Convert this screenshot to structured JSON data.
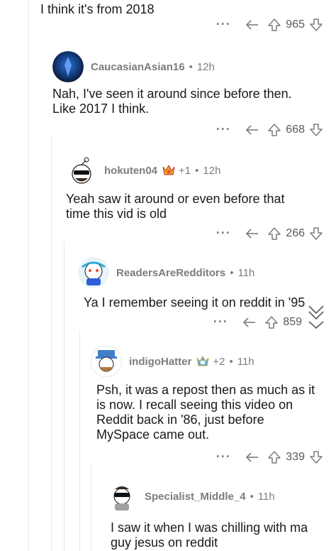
{
  "top_comment": {
    "body": "I think it's from 2018",
    "score": "965"
  },
  "comments": [
    {
      "username": "CaucasianAsian16",
      "time": "12h",
      "body": "Nah, I've seen it around since before then.\nLike 2017 I think.",
      "score": "668"
    },
    {
      "username": "hokuten04",
      "award_count": "+1",
      "time": "12h",
      "body": "Yeah saw it around or even before that\ntime this vid is old",
      "score": "266"
    },
    {
      "username": "ReadersAreRedditors",
      "time": "11h",
      "body": "Ya I remember seeing it on reddit in '95",
      "score": "859"
    },
    {
      "username": "indigoHatter",
      "award_count": "+2",
      "time": "11h",
      "body": "Psh, it was a repost then as much as it\nis now. I recall seeing this video on\nReddit back in '86, just before\nMySpace came out.",
      "score": "339"
    },
    {
      "username": "Specialist_Middle_4",
      "time": "11h",
      "body": "I saw it when I was chilling with ma\nguy jesus on reddit"
    }
  ],
  "icons": {
    "more": "more-options-icon",
    "reply": "reply-icon",
    "upvote": "upvote-icon",
    "downvote": "downvote-icon",
    "collapse": "collapse-chevron-icon"
  },
  "colors": {
    "text": "#1a1a1b",
    "meta": "#7c7c7c",
    "thread_line": "#e6e6e6"
  }
}
